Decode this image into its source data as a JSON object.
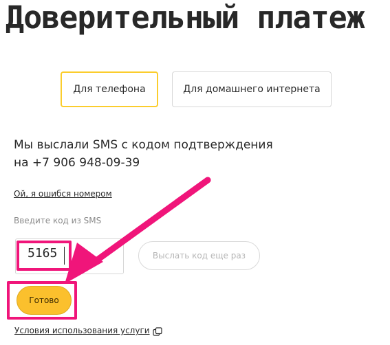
{
  "page": {
    "title": "Доверительный платеж"
  },
  "tabs": [
    {
      "label": "Для телефона",
      "active": true
    },
    {
      "label": "Для домашнего интернета",
      "active": false
    }
  ],
  "sms_notice": {
    "line1": "Мы выслали SMS с кодом подтверждения",
    "line2": "на +7 906 948-09-39"
  },
  "wrong_number_link": "Ой, я ошибся номером",
  "code_form": {
    "label": "Введите код из SMS",
    "value": "5165",
    "resend_label": "Выслать код еще раз",
    "submit_label": "Готово"
  },
  "footer": {
    "terms_link": "Условия использования услуги",
    "terms_icon": "copy-icon"
  },
  "colors": {
    "accent": "#fbc02d",
    "tab_active_border": "#fbcd2d",
    "annotation": "#f0157a",
    "text": "#282828"
  }
}
